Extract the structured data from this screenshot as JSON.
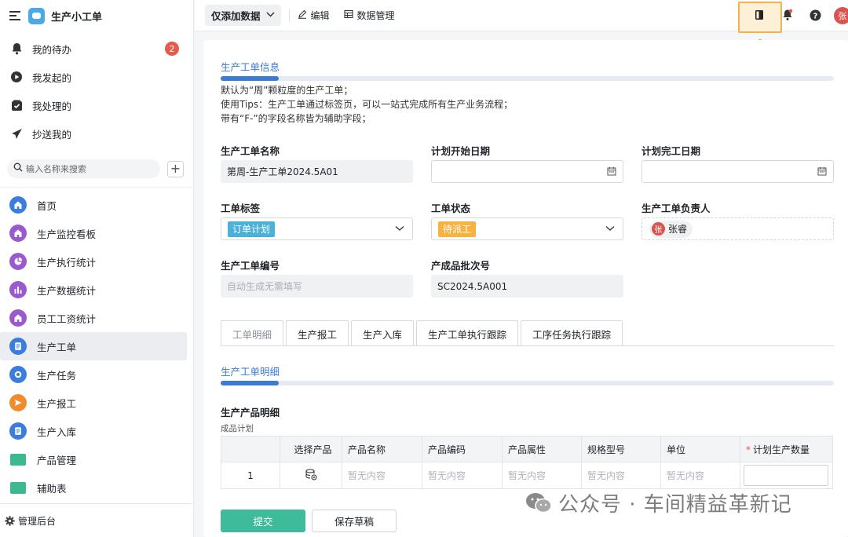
{
  "app": {
    "name": "生产小工单"
  },
  "sidebar": {
    "nav": [
      {
        "label": "我的待办",
        "icon": "bell-icon",
        "badge": "2"
      },
      {
        "label": "我发起的",
        "icon": "play-circle-icon"
      },
      {
        "label": "我处理的",
        "icon": "inbox-check-icon"
      },
      {
        "label": "抄送我的",
        "icon": "send-icon"
      }
    ],
    "search_placeholder": "输入名称来搜索",
    "menu": [
      {
        "label": "首页",
        "icon": "home-icon",
        "color": "#3b7ddd"
      },
      {
        "label": "生产监控看板",
        "icon": "home-icon",
        "color": "#9b59d0"
      },
      {
        "label": "生产执行统计",
        "icon": "pie-chart-icon",
        "color": "#9b59d0"
      },
      {
        "label": "生产数据统计",
        "icon": "bar-chart-icon",
        "color": "#9b59d0"
      },
      {
        "label": "员工工资统计",
        "icon": "home-icon",
        "color": "#9b59d0"
      },
      {
        "label": "生产工单",
        "icon": "document-icon",
        "color": "#3b7ddd",
        "active": true
      },
      {
        "label": "生产任务",
        "icon": "target-icon",
        "color": "#3b7ddd"
      },
      {
        "label": "生产报工",
        "icon": "send-icon",
        "color": "#f08c2e"
      },
      {
        "label": "生产入库",
        "icon": "document-icon",
        "color": "#3b7ddd"
      },
      {
        "label": "产品管理",
        "icon": "folder-icon",
        "color": "#3cb98f"
      },
      {
        "label": "辅助表",
        "icon": "folder-icon",
        "color": "#3cb98f"
      }
    ],
    "footer": "管理后台"
  },
  "toolbar": {
    "view": "仅添加数据",
    "edit": "编辑",
    "data_manage": "数据管理",
    "user_initial": "张"
  },
  "form": {
    "section_title": "生产工单信息",
    "desc": [
      "默认为“周”颗粒度的生产工单；",
      "使用Tips：生产工单通过标签页，可以一站式完成所有生产业务流程；",
      "带有“F-”的字段名称皆为辅助字段；"
    ],
    "fields": {
      "name_label": "生产工单名称",
      "name_value": "第周-生产工单2024.5A01",
      "start_label": "计划开始日期",
      "end_label": "计划完工日期",
      "tag_label": "工单标签",
      "tag_value": "订单计划",
      "tag_color": "#4bb1d6",
      "status_label": "工单状态",
      "status_value": "待派工",
      "status_color": "#f5b342",
      "owner_label": "生产工单负责人",
      "owner_initial": "张",
      "owner_name": "张睿",
      "code_label": "生产工单编号",
      "code_placeholder": "自动生成无需填写",
      "batch_label": "产成品批次号",
      "batch_value": "SC2024.5A001"
    },
    "tabs": [
      "工单明细",
      "生产报工",
      "生产入库",
      "生产工单执行跟踪",
      "工序任务执行跟踪"
    ],
    "detail_title": "生产工单明细",
    "table_title": "生产产品明细",
    "table_sub": "成品计划",
    "columns": [
      "",
      "选择产品",
      "产品名称",
      "产品编码",
      "产品属性",
      "规格型号",
      "单位",
      "计划生产数量"
    ],
    "required_mark": "*",
    "row": {
      "index": "1",
      "empty": "暂无内容"
    },
    "submit": "提交",
    "save_draft": "保存草稿"
  },
  "watermark": "公众号 · 车间精益革新记"
}
